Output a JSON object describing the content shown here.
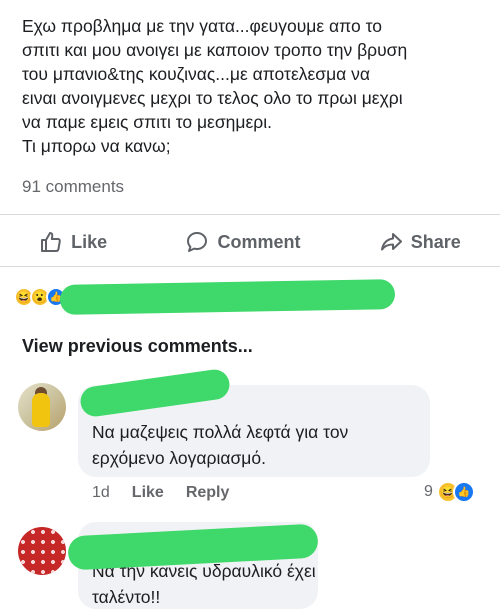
{
  "post": {
    "lines": [
      "Εχω προβλημα με την γατα...φευγουμε απο το",
      "σπιτι και μου ανοιγει με καποιον τροπο την βρυση",
      "του μπανιο&της κουζινας...με αποτελεσμα να",
      "ειναι ανοιγμενες μεχρι το τελος ολο το πρωι μεχρι",
      "να παμε εμεις σπιτι το μεσημερι.",
      "Τι μπορω να κανω;"
    ],
    "comments_count": "91 comments"
  },
  "actions": {
    "like": "Like",
    "comment": "Comment",
    "share": "Share"
  },
  "view_previous": "View previous comments...",
  "comments": [
    {
      "text_lines": [
        "Να μαζεψεις πολλά λεφτά για τον",
        "ερχόμενο λογαριασμό."
      ],
      "time": "1d",
      "like": "Like",
      "reply": "Reply",
      "reaction_count": "9"
    },
    {
      "text_lines": [
        "Να την κανεις υδραυλικό έχει",
        "ταλέντο!!"
      ]
    }
  ],
  "colors": {
    "redaction": "#3fd86a",
    "secondary_text": "#65676b",
    "bubble": "#f0f2f5"
  },
  "icons": [
    "like-icon",
    "comment-icon",
    "share-icon",
    "laugh-emoji-icon",
    "wow-emoji-icon",
    "like-reaction-icon"
  ]
}
